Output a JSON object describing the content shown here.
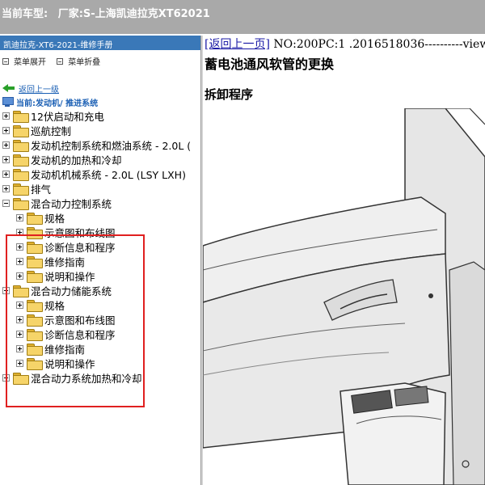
{
  "top_bar": {
    "vehicle_label": "当前车型:",
    "manufacturer": "厂家:S-上海凯迪拉克XT62021"
  },
  "left_panel": {
    "title": "凯迪拉克-XT6-2021-维修手册",
    "expand_menu": "菜单展开",
    "collapse_menu": "菜单折叠",
    "back_link": "返回上一级",
    "current_path": "当前:发动机/ 推进系统",
    "tree": [
      {
        "label": "12伏启动和充电",
        "expanded": false
      },
      {
        "label": "巡航控制",
        "expanded": false
      },
      {
        "label": "发动机控制系统和燃油系统 - 2.0L (",
        "expanded": false
      },
      {
        "label": "发动机的加热和冷却",
        "expanded": false
      },
      {
        "label": "发动机机械系统 - 2.0L (LSY LXH)",
        "expanded": false
      },
      {
        "label": "排气",
        "expanded": false
      },
      {
        "label": "混合动力控制系统",
        "expanded": true,
        "children": [
          {
            "label": "规格"
          },
          {
            "label": "示意图和布线图"
          },
          {
            "label": "诊断信息和程序"
          },
          {
            "label": "维修指南"
          },
          {
            "label": "说明和操作"
          }
        ]
      },
      {
        "label": "混合动力储能系统",
        "expanded": true,
        "children": [
          {
            "label": "规格"
          },
          {
            "label": "示意图和布线图"
          },
          {
            "label": "诊断信息和程序"
          },
          {
            "label": "维修指南"
          },
          {
            "label": "说明和操作"
          }
        ]
      },
      {
        "label": "混合动力系统加热和冷却",
        "expanded": false
      }
    ],
    "highlight_color": "#e02020"
  },
  "document": {
    "back_link": "[返回上一页]",
    "doc_info": " NO:200PC:1 .2016518036----------view",
    "title": "蓄电池通风软管的更换",
    "section": "拆卸程序"
  },
  "colors": {
    "top_bar_bg": "#a9a9a9",
    "panel_title_bg": "#3a78b8",
    "link_blue": "#1a5fb4"
  }
}
